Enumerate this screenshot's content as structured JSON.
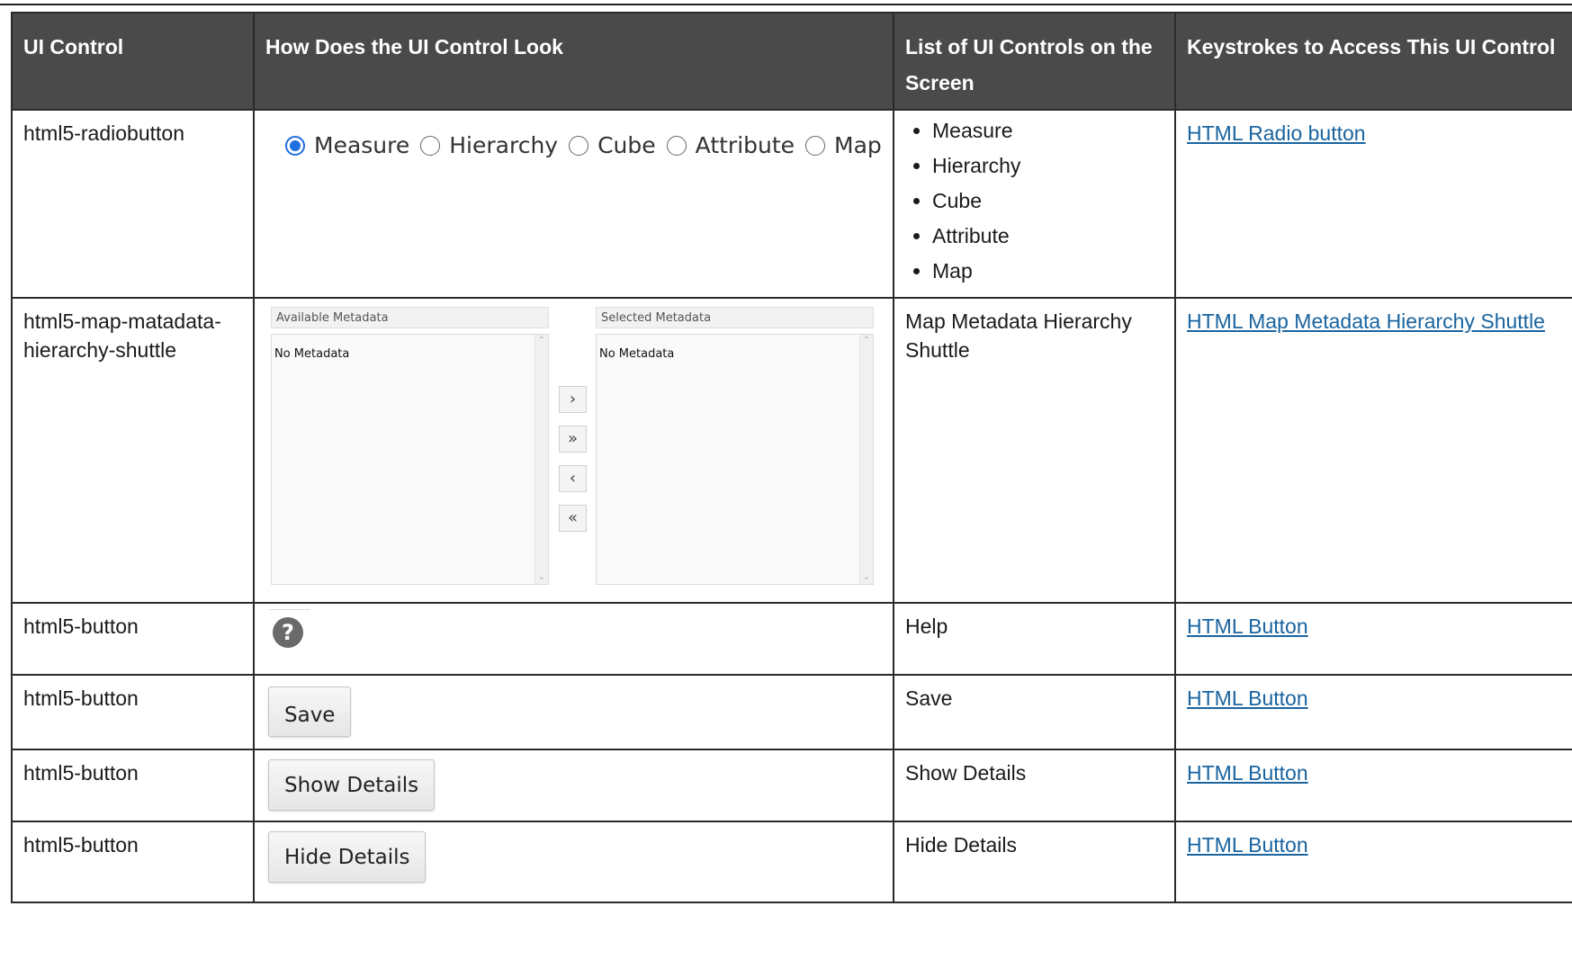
{
  "headers": [
    "UI Control",
    "How Does the UI Control Look",
    "List of UI Controls on the Screen",
    "Keystrokes to Access This UI Control"
  ],
  "rows": [
    {
      "control": "html5-radiobutton",
      "look": {
        "radio_labels": [
          "Measure",
          "Hierarchy",
          "Cube",
          "Attribute",
          "Map"
        ],
        "selected": "Measure"
      },
      "list": [
        "Measure",
        "Hierarchy",
        "Cube",
        "Attribute",
        "Map"
      ],
      "link": "HTML Radio button"
    },
    {
      "control": "html5-map-matadata-hierarchy-shuttle",
      "look": {
        "available_header": "Available Metadata",
        "selected_header": "Selected Metadata",
        "available_empty": "No Metadata",
        "selected_empty": "No Metadata",
        "buttons": [
          "›",
          "»",
          "‹",
          "«"
        ]
      },
      "list_text": "Map Metadata Hierarchy Shuttle",
      "link": "HTML Map Metadata Hierarchy Shuttle"
    },
    {
      "control": "html5-button",
      "look": {
        "icon": "help-icon",
        "glyph": "?"
      },
      "list_text": "Help",
      "link": "HTML Button"
    },
    {
      "control": "html5-button",
      "look": {
        "button_label": "Save"
      },
      "list_text": "Save",
      "link": "HTML Button"
    },
    {
      "control": "html5-button",
      "look": {
        "button_label": "Show Details"
      },
      "list_text": "Show Details",
      "link": "HTML Button"
    },
    {
      "control": "html5-button",
      "look": {
        "button_label": "Hide Details"
      },
      "list_text": "Hide Details",
      "link": "HTML Button"
    }
  ],
  "colors": {
    "header_bg": "#4a4a4a",
    "link": "#1a64a0",
    "radio_selected": "#1f6fe0"
  }
}
